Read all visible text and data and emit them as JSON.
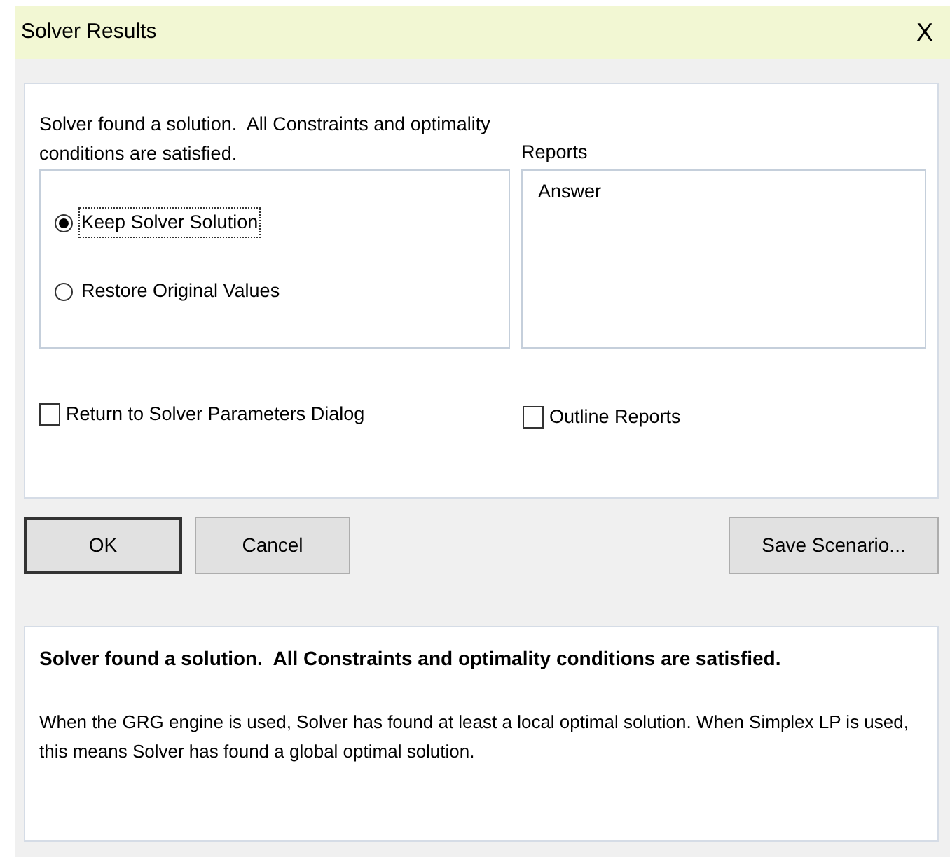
{
  "window": {
    "title": "Solver Results",
    "close": "X"
  },
  "message": "Solver found a solution.  All Constraints and optimality conditions are satisfied.",
  "options": [
    {
      "label": "Keep Solver Solution",
      "selected": true,
      "focused": true
    },
    {
      "label": "Restore Original Values",
      "selected": false,
      "focused": false
    }
  ],
  "reports": {
    "label": "Reports",
    "items": [
      {
        "label": "Answer",
        "selected": false
      }
    ]
  },
  "checkboxes": [
    {
      "label": "Return to Solver Parameters Dialog",
      "checked": false
    },
    {
      "label": "Outline Reports",
      "checked": false
    }
  ],
  "buttons": [
    {
      "label": "OK",
      "default": true
    },
    {
      "label": "Cancel",
      "default": false
    },
    {
      "label": "Save Scenario...",
      "default": false
    }
  ],
  "details": {
    "heading": "Solver found a solution.  All Constraints and optimality conditions are satisfied.",
    "text": "When the GRG engine is used, Solver has found at least a local optimal solution. When Simplex LP is used, this means Solver has found a global optimal solution."
  }
}
